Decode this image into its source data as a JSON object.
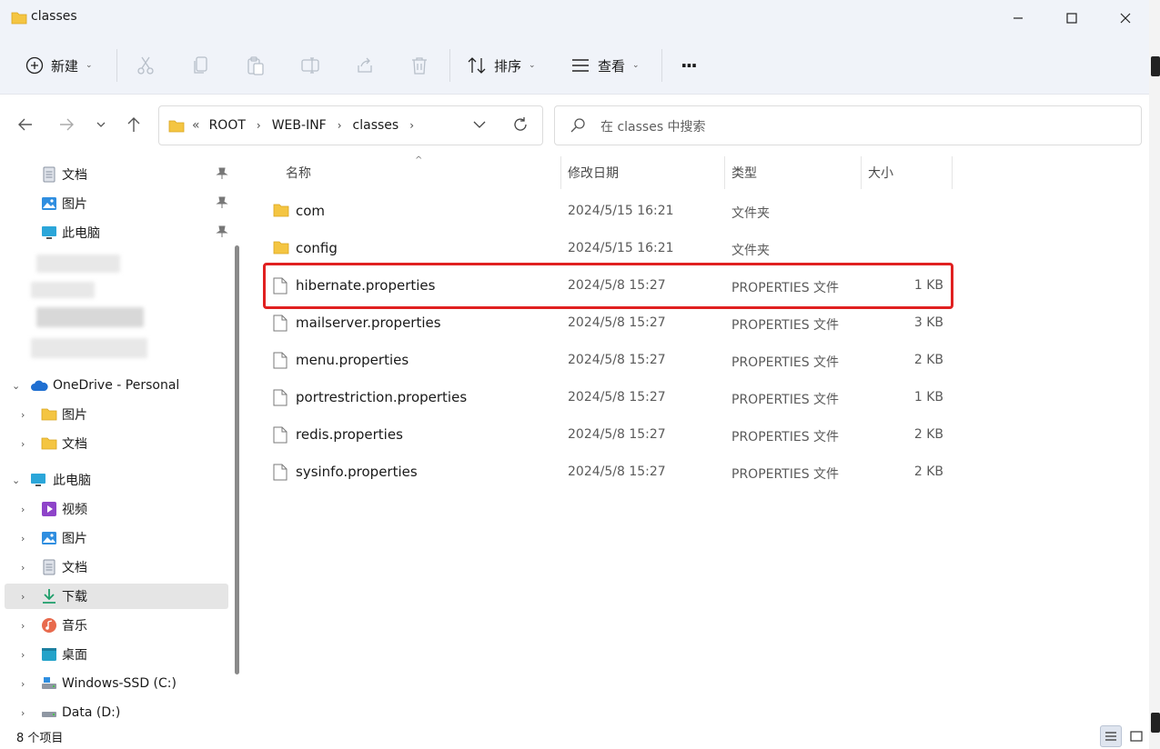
{
  "window": {
    "title": "classes"
  },
  "toolbar": {
    "new_label": "新建",
    "sort_label": "排序",
    "view_label": "查看",
    "more_label": "···"
  },
  "address": {
    "overflow": "«",
    "crumbs": [
      "ROOT",
      "WEB-INF",
      "classes"
    ]
  },
  "search": {
    "placeholder": "在 classes 中搜索"
  },
  "sidebar": {
    "quick_access": [
      {
        "label": "文档",
        "icon": "document-icon"
      },
      {
        "label": "图片",
        "icon": "pictures-icon"
      },
      {
        "label": "此电脑",
        "icon": "computer-icon"
      }
    ],
    "onedrive": {
      "label": "OneDrive - Personal",
      "children": [
        {
          "label": "图片"
        },
        {
          "label": "文档"
        }
      ]
    },
    "this_pc": {
      "label": "此电脑",
      "children": [
        {
          "label": "视频",
          "icon": "videos-icon"
        },
        {
          "label": "图片",
          "icon": "pictures-icon"
        },
        {
          "label": "文档",
          "icon": "document-icon"
        },
        {
          "label": "下载",
          "icon": "download-icon"
        },
        {
          "label": "音乐",
          "icon": "music-icon"
        },
        {
          "label": "桌面",
          "icon": "desktop-icon"
        },
        {
          "label": "Windows-SSD (C:)",
          "icon": "drive-icon"
        },
        {
          "label": "Data (D:)",
          "icon": "drive-icon"
        }
      ]
    }
  },
  "columns": {
    "name": "名称",
    "modified": "修改日期",
    "type": "类型",
    "size": "大小"
  },
  "files": [
    {
      "name": "com",
      "date": "2024/5/15 16:21",
      "type": "文件夹",
      "size": "",
      "kind": "folder"
    },
    {
      "name": "config",
      "date": "2024/5/15 16:21",
      "type": "文件夹",
      "size": "",
      "kind": "folder"
    },
    {
      "name": "hibernate.properties",
      "date": "2024/5/8 15:27",
      "type": "PROPERTIES 文件",
      "size": "1 KB",
      "kind": "file"
    },
    {
      "name": "mailserver.properties",
      "date": "2024/5/8 15:27",
      "type": "PROPERTIES 文件",
      "size": "3 KB",
      "kind": "file"
    },
    {
      "name": "menu.properties",
      "date": "2024/5/8 15:27",
      "type": "PROPERTIES 文件",
      "size": "2 KB",
      "kind": "file"
    },
    {
      "name": "portrestriction.properties",
      "date": "2024/5/8 15:27",
      "type": "PROPERTIES 文件",
      "size": "1 KB",
      "kind": "file"
    },
    {
      "name": "redis.properties",
      "date": "2024/5/8 15:27",
      "type": "PROPERTIES 文件",
      "size": "2 KB",
      "kind": "file"
    },
    {
      "name": "sysinfo.properties",
      "date": "2024/5/8 15:27",
      "type": "PROPERTIES 文件",
      "size": "2 KB",
      "kind": "file"
    }
  ],
  "status": {
    "item_count": "8 个项目"
  },
  "colors": {
    "highlight": "#e02020",
    "folder": "#f4c542",
    "accent": "#1f6fd1"
  }
}
